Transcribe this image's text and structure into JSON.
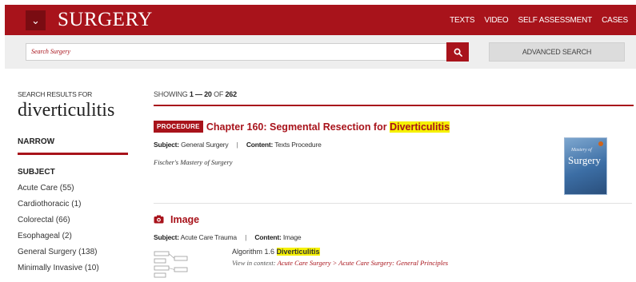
{
  "header": {
    "brand": "SURGERY",
    "menu_icon": "chevron-down-icon",
    "nav": [
      "TEXTS",
      "VIDEO",
      "SELF ASSESSMENT",
      "CASES"
    ]
  },
  "search": {
    "placeholder": "Search Surgery",
    "button_icon": "search-icon",
    "advanced_label": "ADVANCED SEARCH"
  },
  "sidebar": {
    "results_for_label": "SEARCH RESULTS FOR",
    "query": "diverticulitis",
    "narrow_label": "NARROW",
    "subject_label": "SUBJECT",
    "facets": [
      "Acute Care (55)",
      "Cardiothoracic (1)",
      "Colorectal (66)",
      "Esophageal (2)",
      "General Surgery (138)",
      "Minimally Invasive (10)"
    ]
  },
  "results": {
    "showing_prefix": "SHOWING",
    "range": "1 — 20",
    "of_label": "OF",
    "total": "262",
    "items": [
      {
        "type_tag": "PROCEDURE",
        "title_prefix": "Chapter 160: Segmental Resection for ",
        "title_highlight": "Diverticulitis",
        "subject_label": "Subject:",
        "subject": "General Surgery",
        "content_label": "Content:",
        "content": "Texts Procedure",
        "source": "Fischer's Mastery of Surgery",
        "cover_line1": "Mastery of",
        "cover_line2": "Surgery"
      },
      {
        "type_icon": "camera-icon",
        "title": "Image",
        "subject_label": "Subject:",
        "subject": "Acute Care Trauma",
        "content_label": "Content:",
        "content": "Image",
        "algo_prefix": "Algorithm 1.6 ",
        "algo_highlight": "Diverticulitis",
        "context_label": "View in context:",
        "context_link": "Acute Care Surgery > Acute Care Surgery: General Principles"
      }
    ]
  },
  "colors": {
    "brand_red": "#a8131b",
    "highlight": "#f5f100"
  }
}
